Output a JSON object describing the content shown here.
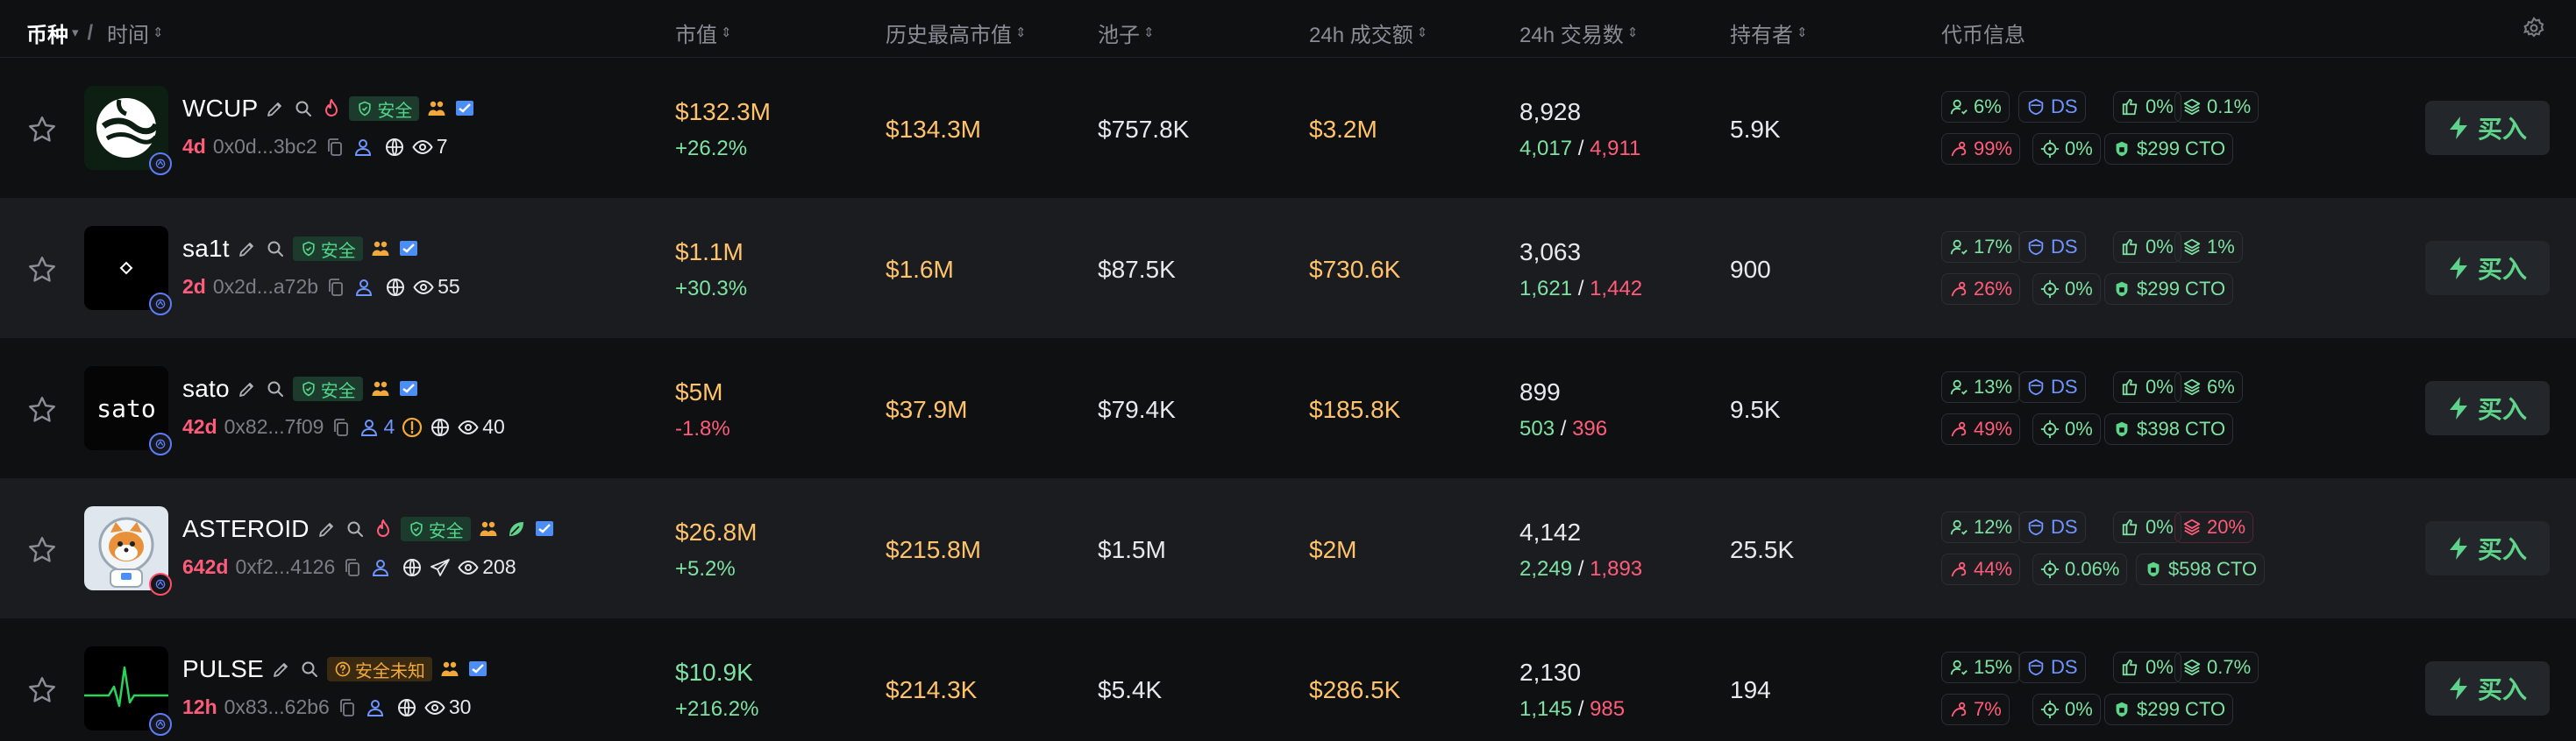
{
  "header": {
    "col_token": "币种",
    "col_time": "时间",
    "col_mcap": "市值",
    "col_ath": "历史最高市值",
    "col_pool": "池子",
    "col_vol": "24h 成交额",
    "col_txns": "24h 交易数",
    "col_holders": "持有者",
    "col_info": "代币信息"
  },
  "colors": {
    "accent_green": "#5fd38a",
    "accent_red": "#ff5c7a",
    "accent_yellow": "#ffc36b",
    "accent_blue": "#6f95ff"
  },
  "rows": [
    {
      "name": "WCUP",
      "age": "4d",
      "address": "0x0d...3bc2",
      "safety": "安全",
      "safety_status": "safe",
      "has_fire": true,
      "views": "7",
      "holders_icon_count": "",
      "mcap": "$132.3M",
      "mcap_change": "+26.2%",
      "mcap_change_dir": "up",
      "mcap_color": "yellow",
      "ath": "$134.3M",
      "pool": "$757.8K",
      "volume": "$3.2M",
      "txns": "8,928",
      "buys": "4,017",
      "sells": "4,911",
      "holders": "5.9K",
      "info": {
        "top10": "6%",
        "ds": "DS",
        "dev": "0%",
        "snipers": "0.1%",
        "insiders": "99%",
        "bundle": "0%",
        "cto": "$299 CTO"
      },
      "buy_label": "买入"
    },
    {
      "name": "sa1t",
      "age": "2d",
      "address": "0x2d...a72b",
      "safety": "安全",
      "safety_status": "safe",
      "has_fire": false,
      "views": "55",
      "holders_icon_count": "",
      "mcap": "$1.1M",
      "mcap_change": "+30.3%",
      "mcap_change_dir": "up",
      "mcap_color": "yellow",
      "ath": "$1.6M",
      "pool": "$87.5K",
      "volume": "$730.6K",
      "txns": "3,063",
      "buys": "1,621",
      "sells": "1,442",
      "holders": "900",
      "info": {
        "top10": "17%",
        "ds": "DS",
        "dev": "0%",
        "snipers": "1%",
        "insiders": "26%",
        "bundle": "0%",
        "cto": "$299 CTO"
      },
      "buy_label": "买入"
    },
    {
      "name": "sato",
      "age": "42d",
      "address": "0x82...7f09",
      "safety": "安全",
      "safety_status": "safe",
      "has_fire": false,
      "views": "40",
      "holders_icon_count": "4",
      "mcap": "$5M",
      "mcap_change": "-1.8%",
      "mcap_change_dir": "down",
      "mcap_color": "yellow",
      "ath": "$37.9M",
      "pool": "$79.4K",
      "volume": "$185.8K",
      "txns": "899",
      "buys": "503",
      "sells": "396",
      "holders": "9.5K",
      "info": {
        "top10": "13%",
        "ds": "DS",
        "dev": "0%",
        "snipers": "6%",
        "insiders": "49%",
        "bundle": "0%",
        "cto": "$398 CTO"
      },
      "buy_label": "买入"
    },
    {
      "name": "ASTEROID",
      "age": "642d",
      "address": "0xf2...4126",
      "safety": "安全",
      "safety_status": "safe",
      "has_fire": true,
      "views": "208",
      "holders_icon_count": "",
      "mcap": "$26.8M",
      "mcap_change": "+5.2%",
      "mcap_change_dir": "up",
      "mcap_color": "yellow",
      "ath": "$215.8M",
      "pool": "$1.5M",
      "volume": "$2M",
      "txns": "4,142",
      "buys": "2,249",
      "sells": "1,893",
      "holders": "25.5K",
      "info": {
        "top10": "12%",
        "ds": "DS",
        "dev": "0%",
        "snipers": "20%",
        "insiders": "44%",
        "bundle": "0.06%",
        "cto": "$598 CTO"
      },
      "buy_label": "买入"
    },
    {
      "name": "PULSE",
      "age": "12h",
      "address": "0x83...62b6",
      "safety": "安全未知",
      "safety_status": "unknown",
      "has_fire": false,
      "views": "30",
      "holders_icon_count": "",
      "mcap": "$10.9K",
      "mcap_change": "+216.2%",
      "mcap_change_dir": "up",
      "mcap_color": "green",
      "ath": "$214.3K",
      "pool": "$5.4K",
      "volume": "$286.5K",
      "txns": "2,130",
      "buys": "1,145",
      "sells": "985",
      "holders": "194",
      "info": {
        "top10": "15%",
        "ds": "DS",
        "dev": "0%",
        "snipers": "0.7%",
        "insiders": "7%",
        "bundle": "0%",
        "cto": "$299 CTO"
      },
      "buy_label": "买入"
    }
  ]
}
